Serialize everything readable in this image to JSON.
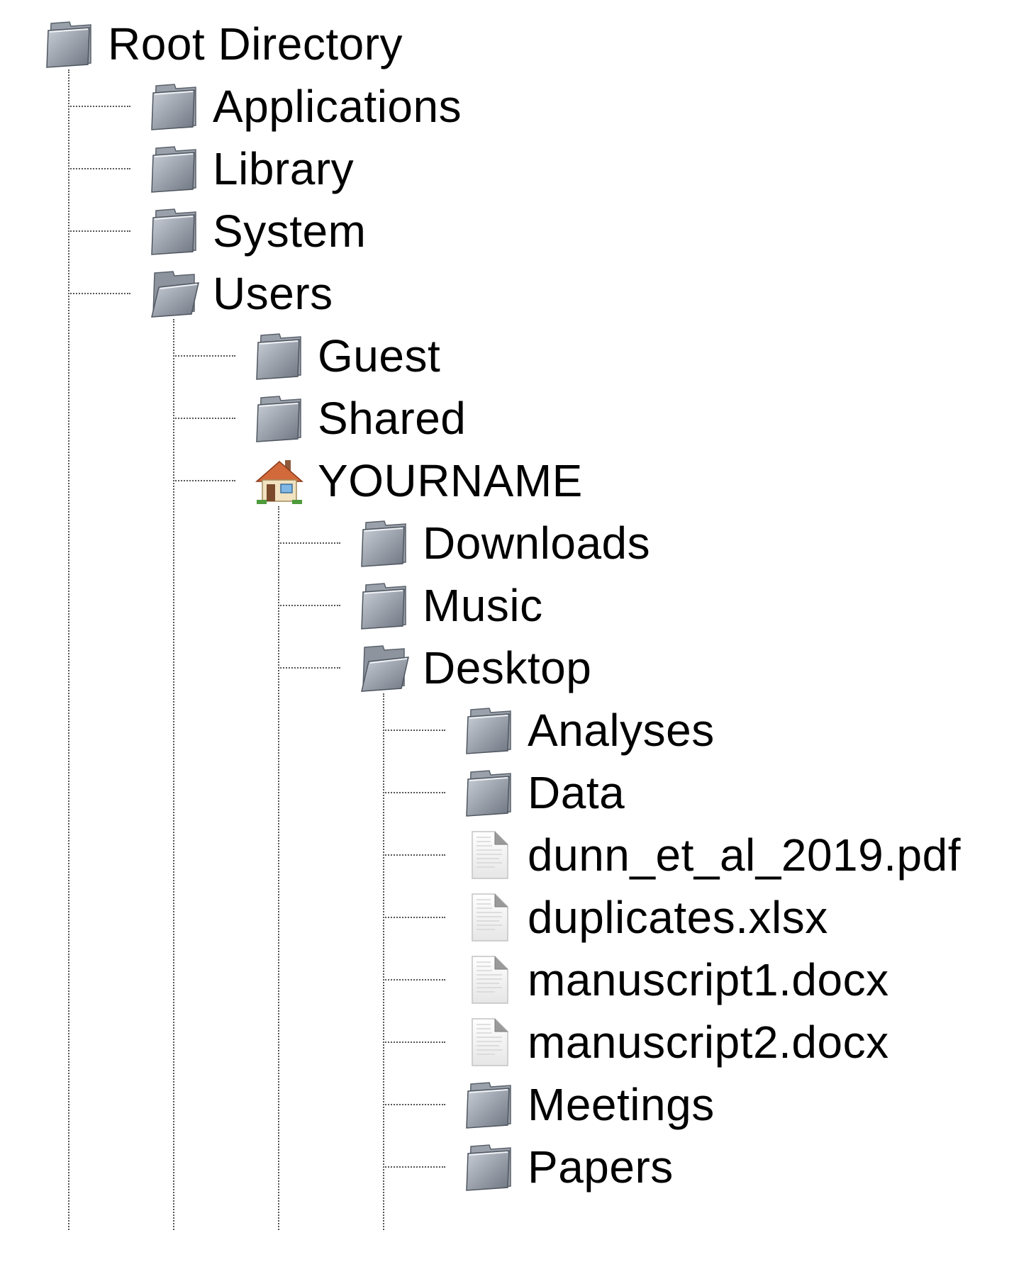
{
  "tree": {
    "label": "Root Directory",
    "icon": "folder-icon",
    "children": [
      {
        "label": "Applications",
        "icon": "folder-icon"
      },
      {
        "label": "Library",
        "icon": "folder-icon"
      },
      {
        "label": "System",
        "icon": "folder-icon"
      },
      {
        "label": "Users",
        "icon": "open-folder-icon",
        "children": [
          {
            "label": "Guest",
            "icon": "folder-icon"
          },
          {
            "label": "Shared",
            "icon": "folder-icon"
          },
          {
            "label": "YOURNAME",
            "icon": "home-icon",
            "children": [
              {
                "label": "Downloads",
                "icon": "folder-icon"
              },
              {
                "label": "Music",
                "icon": "folder-icon"
              },
              {
                "label": "Desktop",
                "icon": "open-folder-icon",
                "children": [
                  {
                    "label": "Analyses",
                    "icon": "folder-icon"
                  },
                  {
                    "label": "Data",
                    "icon": "folder-icon"
                  },
                  {
                    "label": "dunn_et_al_2019.pdf",
                    "icon": "document-icon"
                  },
                  {
                    "label": "duplicates.xlsx",
                    "icon": "document-icon"
                  },
                  {
                    "label": "manuscript1.docx",
                    "icon": "document-icon"
                  },
                  {
                    "label": "manuscript2.docx",
                    "icon": "document-icon"
                  },
                  {
                    "label": "Meetings",
                    "icon": "folder-icon"
                  },
                  {
                    "label": "Papers",
                    "icon": "folder-icon"
                  }
                ]
              }
            ]
          }
        ]
      }
    ]
  },
  "colors": {
    "folder_light": "#c9ced6",
    "folder_dark": "#6e7682",
    "connector": "#555555",
    "text": "#000000"
  }
}
